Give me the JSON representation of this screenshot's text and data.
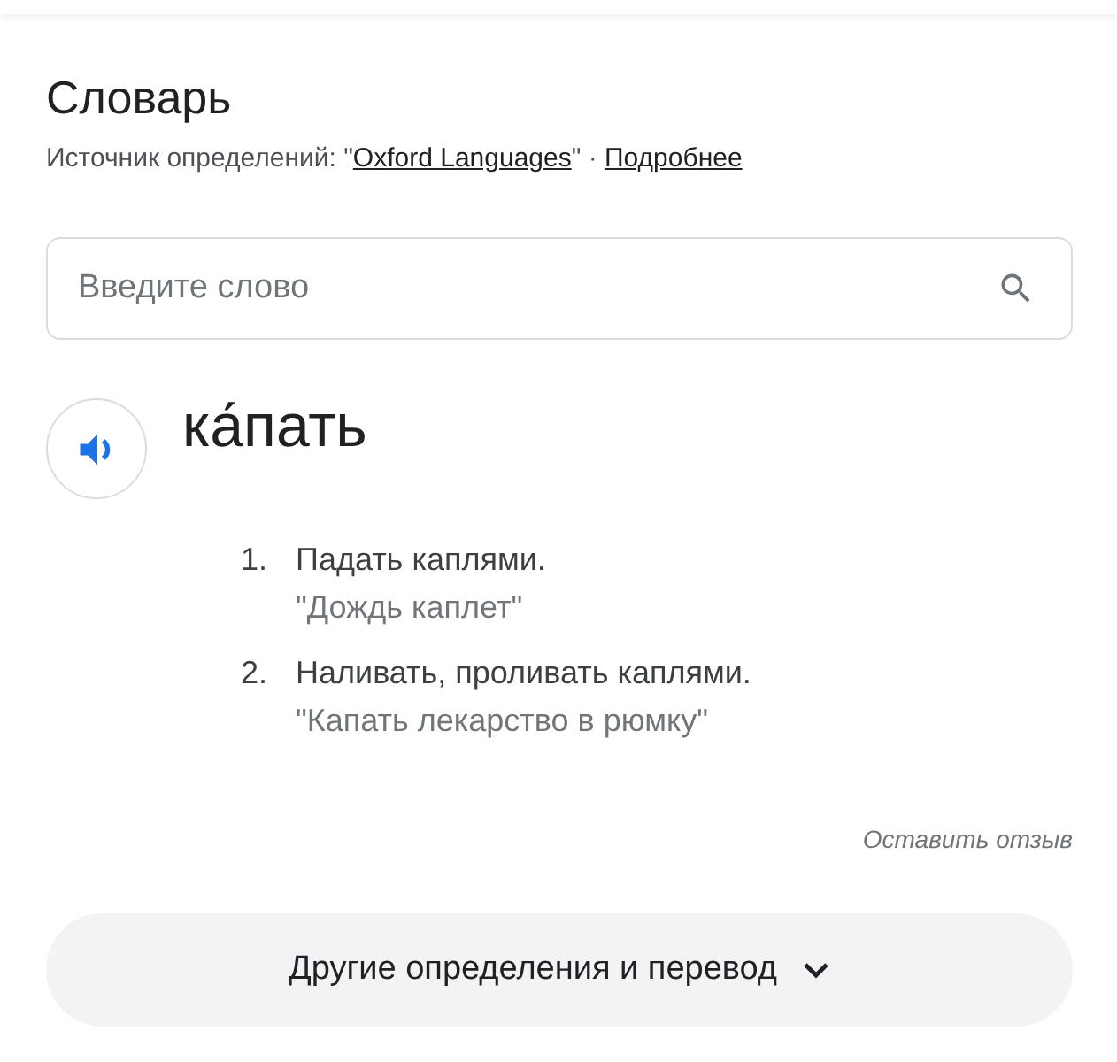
{
  "title": "Словарь",
  "source": {
    "prefix": "Источник определений: \"",
    "link": "Oxford Languages",
    "separator": "\" · ",
    "more_link": "Подробнее"
  },
  "search": {
    "placeholder": "Введите слово"
  },
  "entry": {
    "word": "ка́пать",
    "definitions": [
      {
        "number": "1.",
        "text": "Падать каплями.",
        "example": "\"Дождь каплет\""
      },
      {
        "number": "2.",
        "text": "Наливать, проливать каплями.",
        "example": "\"Капать лекарство в рюмку\""
      }
    ]
  },
  "feedback": "Оставить отзыв",
  "more_button": "Другие определения и перевод"
}
